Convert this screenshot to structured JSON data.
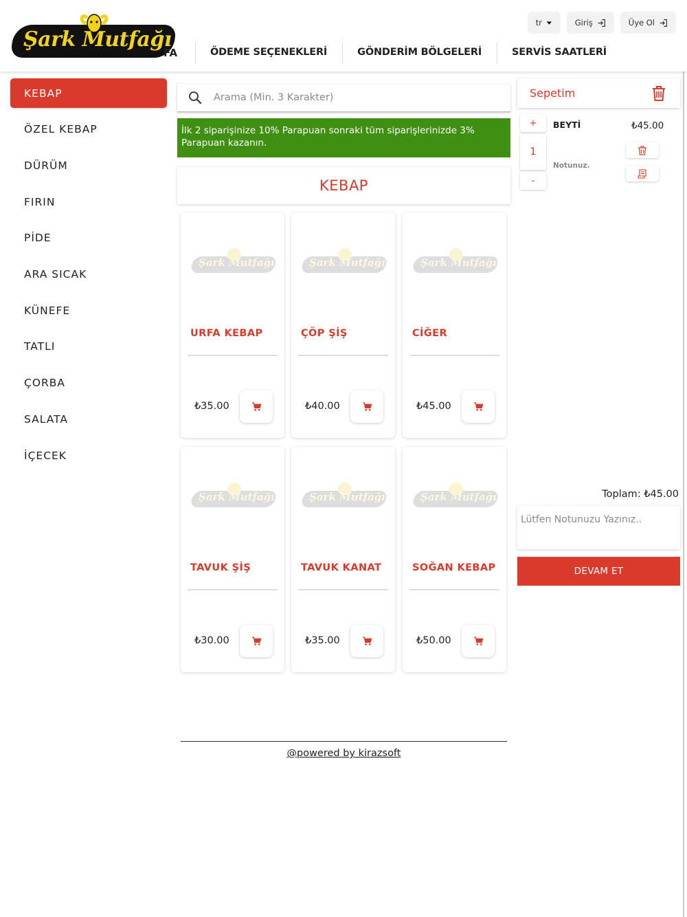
{
  "header": {
    "logo_text": "Şark Mutfağı",
    "nav_cut": "FA",
    "nav": [
      "ÖDEME SEÇENEKLERİ",
      "GÖNDERİM BÖLGELERİ",
      "SERVİS SAATLERİ"
    ],
    "lang": "tr",
    "login": "Giriş",
    "register": "Üye Ol"
  },
  "sidebar": {
    "items": [
      "KEBAP",
      "ÖZEL KEBAP",
      "DÜRÜM",
      "FIRIN",
      "PİDE",
      "ARA SICAK",
      "KÜNEFE",
      "TATLI",
      "ÇORBA",
      "SALATA",
      "İÇECEK"
    ],
    "active": "KEBAP"
  },
  "search": {
    "placeholder": "Arama (Min. 3 Karakter)"
  },
  "promo": "İlk 2 siparişinize 10% Parapuan sonraki tüm siparişlerinizde 3% Parapuan kazanın.",
  "section_title": "KEBAP",
  "products": [
    {
      "name": "URFA KEBAP",
      "price": "₺35.00"
    },
    {
      "name": "ÇÖP ŞİŞ",
      "price": "₺40.00"
    },
    {
      "name": "CİĞER",
      "price": "₺45.00"
    },
    {
      "name": "TAVUK ŞİŞ",
      "price": "₺30.00"
    },
    {
      "name": "TAVUK KANAT",
      "price": "₺35.00"
    },
    {
      "name": "SOĞAN KEBAP",
      "price": "₺50.00"
    }
  ],
  "card_logo_text": "Şark Mutfağı",
  "basket": {
    "title": "Sepetim",
    "item": {
      "name": "BEYTİ",
      "price": "₺45.00",
      "qty": "1",
      "note": "Notunuz.",
      "plus": "+",
      "minus": "-"
    },
    "total": "Toplam: ₺45.00",
    "note_placeholder": "Lütfen Notunuzu Yazınız..",
    "continue": "DEVAM ET"
  },
  "footer": "@powered by kirazsoft",
  "colors": {
    "accent": "#d93a2b",
    "promo": "#3f8f12",
    "logo_yellow": "#f2d21a"
  }
}
